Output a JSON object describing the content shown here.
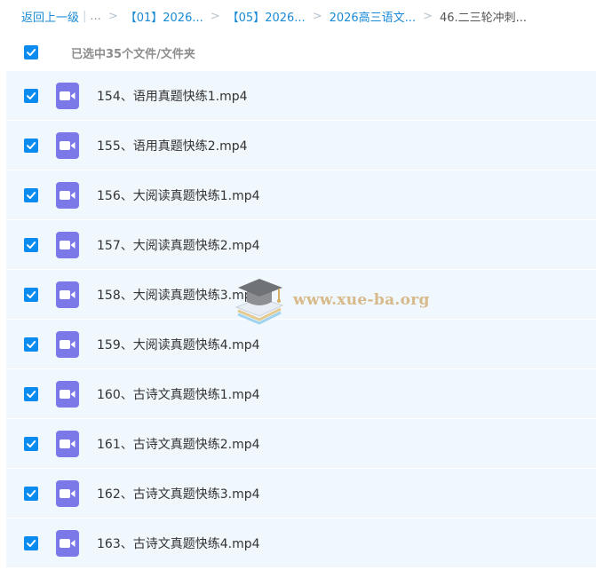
{
  "breadcrumb": {
    "back": "返回上一级",
    "ellipsis": "...",
    "items": [
      "【01】2026...",
      "【05】2026...",
      "2026高三语文..."
    ],
    "current": "46.二三轮冲刺..."
  },
  "selection": {
    "label": "已选中35个文件/文件夹",
    "all_checked": true
  },
  "files": [
    {
      "name": "154、语用真题快练1.mp4",
      "checked": true
    },
    {
      "name": "155、语用真题快练2.mp4",
      "checked": true
    },
    {
      "name": "156、大阅读真题快练1.mp4",
      "checked": true
    },
    {
      "name": "157、大阅读真题快练2.mp4",
      "checked": true
    },
    {
      "name": "158、大阅读真题快练3.mp4",
      "checked": true
    },
    {
      "name": "159、大阅读真题快练4.mp4",
      "checked": true
    },
    {
      "name": "160、古诗文真题快练1.mp4",
      "checked": true
    },
    {
      "name": "161、古诗文真题快练2.mp4",
      "checked": true
    },
    {
      "name": "162、古诗文真题快练3.mp4",
      "checked": true
    },
    {
      "name": "163、古诗文真题快练4.mp4",
      "checked": true
    }
  ],
  "icons": {
    "checkbox": "check-icon",
    "file": "video-file-icon"
  },
  "colors": {
    "accent": "#0a8bf0",
    "link": "#1a8ad6",
    "row_bg": "#f0f7fd",
    "video_icon": "#7b78e8"
  },
  "watermark": {
    "text": "www.xue-ba.org"
  }
}
